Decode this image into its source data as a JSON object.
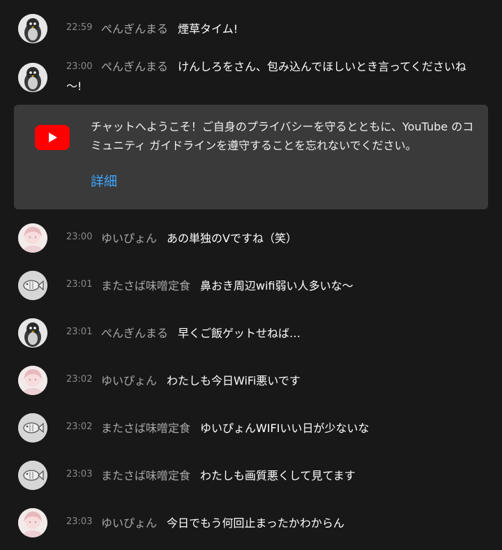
{
  "messages": [
    {
      "time": "22:59",
      "author": "ぺんぎんまる",
      "text": "煙草タイム!",
      "avatar": "penguin-avatar-icon"
    },
    {
      "time": "23:00",
      "author": "ぺんぎんまる",
      "text": "けんしろをさん、包み込んでほしいとき言ってくださいね",
      "text_cont": "〜!",
      "avatar": "penguin-avatar-icon"
    },
    {
      "time": "23:00",
      "author": "ゆいぴょん",
      "text": "あの単独のVですね（笑）",
      "avatar": "girl-avatar-icon"
    },
    {
      "time": "23:01",
      "author": "またさば味噌定食",
      "text": "鼻おき周辺wifi弱い人多いな〜",
      "avatar": "fish-avatar-icon"
    },
    {
      "time": "23:01",
      "author": "ぺんぎんまる",
      "text": "早くご飯ゲットせねば…",
      "avatar": "penguin-avatar-icon"
    },
    {
      "time": "23:02",
      "author": "ゆいぴょん",
      "text": "わたしも今日WiFi悪いです",
      "avatar": "girl-avatar-icon"
    },
    {
      "time": "23:02",
      "author": "またさば味噌定食",
      "text": "ゆいぴょんWIFIいい日が少ないな",
      "avatar": "fish-avatar-icon"
    },
    {
      "time": "23:03",
      "author": "またさば味噌定食",
      "text": "わたしも画質悪くして見てます",
      "avatar": "fish-avatar-icon"
    },
    {
      "time": "23:03",
      "author": "ゆいぴょん",
      "text": "今日でもう何回止まったかわからん",
      "avatar": "girl-avatar-icon"
    }
  ],
  "notice": {
    "text": "チャットへようこそ！ご自身のプライバシーを守るとともに、YouTube のコミュニティ ガイドラインを遵守することを忘れないでください。",
    "link_label": "詳細",
    "icon": "youtube-logo-icon"
  },
  "colors": {
    "background": "#181818",
    "notice_background": "#3a3a3a",
    "link": "#3ea6ff",
    "author": "#a9a9a9",
    "time": "#8a8a8a",
    "youtube_red": "#ff0000"
  }
}
